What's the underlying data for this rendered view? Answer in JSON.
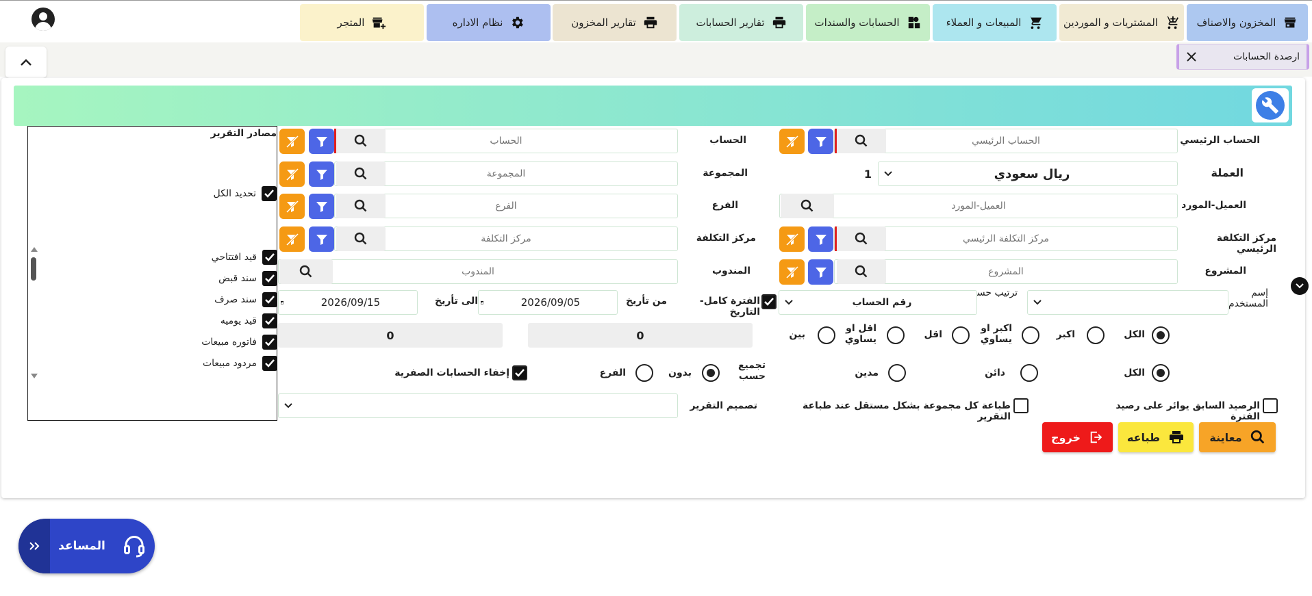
{
  "nav": {
    "items": [
      {
        "label": "المخزون والاصناف",
        "color": "#adc8f0",
        "icon": "store-icon"
      },
      {
        "label": "المشتريات و الموردين",
        "color": "#f1ead3",
        "icon": "cart-plus-icon"
      },
      {
        "label": "المبيعات و العملاء",
        "color": "#ade6ef",
        "icon": "cart-icon"
      },
      {
        "label": "الحسابات والسندات",
        "color": "#c5eec7",
        "icon": "accounts-icon"
      },
      {
        "label": "تقارير الحسابات",
        "color": "#cdeedd",
        "icon": "printer-icon"
      },
      {
        "label": "تقارير المخزون",
        "color": "#ece4d1",
        "icon": "printer-icon"
      },
      {
        "label": "نظام الاداره",
        "color": "#adbff0",
        "icon": "gear-icon"
      },
      {
        "label": "المتجر",
        "color": "#fbf2cb",
        "icon": "store-add-icon"
      }
    ]
  },
  "tab": {
    "label": "ارصدة الحسابات"
  },
  "form": {
    "main_account": {
      "label": "الحساب الرئيسي",
      "placeholder": "الحساب الرئيسي"
    },
    "account": {
      "label": "الحساب",
      "placeholder": "الحساب"
    },
    "currency": {
      "label": "العملة",
      "value": "ريال سعودي",
      "rate": "1"
    },
    "group": {
      "label": "المجموعة",
      "placeholder": "المجموعة"
    },
    "customer_supplier": {
      "label": "العميل-المورد",
      "placeholder": "العميل-المورد"
    },
    "branch": {
      "label": "الفرع",
      "placeholder": "الفرع"
    },
    "main_cost_center": {
      "label": "مركز التكلفة الرئيسي",
      "placeholder": "مركز التكلفة الرئيسي"
    },
    "cost_center": {
      "label": "مركز التكلفة",
      "placeholder": "مركز التكلفة"
    },
    "project": {
      "label": "المشروع",
      "placeholder": "المشروع"
    },
    "delegate": {
      "label": "المندوب",
      "placeholder": "المندوب"
    },
    "username": {
      "label": "إسم المستخدم",
      "value": ""
    },
    "sort_by": {
      "label": "ترتيب حسب",
      "value": "رقم الحساب"
    },
    "full_period": {
      "label": "الفترة كامل-التاريخ",
      "checked": true
    },
    "from_date": {
      "label": "من تأريخ",
      "value": "2026/09/05"
    },
    "to_date": {
      "label": "الى تأريخ",
      "value": "2026/09/15"
    },
    "compare": {
      "options": [
        "الكل",
        "اكبر",
        "اكبر او يساوي",
        "اقل",
        "اقل او يساوي",
        "بين"
      ],
      "selected": "الكل",
      "value1": "0",
      "value2": "0"
    },
    "balance_type": {
      "options": [
        "الكل",
        "دائن",
        "مدين"
      ],
      "selected": "الكل"
    },
    "group_by": {
      "label": "تجميع حسب",
      "options": [
        "بدون",
        "الفرع"
      ],
      "selected": "بدون"
    },
    "hide_zero": {
      "label": "إخفاء الحسابات الصفرية",
      "checked": true
    },
    "prev_balance": {
      "label": "الرصيد السابق يوائر على رصيد الفترة",
      "checked": false
    },
    "print_each_group": {
      "label": "طباعة كل مجموعة بشكل مستقل عند طباعة التقرير",
      "checked": false
    },
    "report_design": {
      "label": "تصميم التقرير",
      "value": ""
    }
  },
  "sources": {
    "title": "مصادر التقرير",
    "select_all": "تحديد الكل",
    "items": [
      "قيد افتتاحي",
      "سند قبض",
      "سند صرف",
      "قيد يوميه",
      "فاتوره مبيعات",
      "مردود مبيعات"
    ]
  },
  "actions": {
    "preview": "معاينة",
    "print": "طباعه",
    "exit": "خروج"
  },
  "helper": {
    "label": "المساعد"
  }
}
